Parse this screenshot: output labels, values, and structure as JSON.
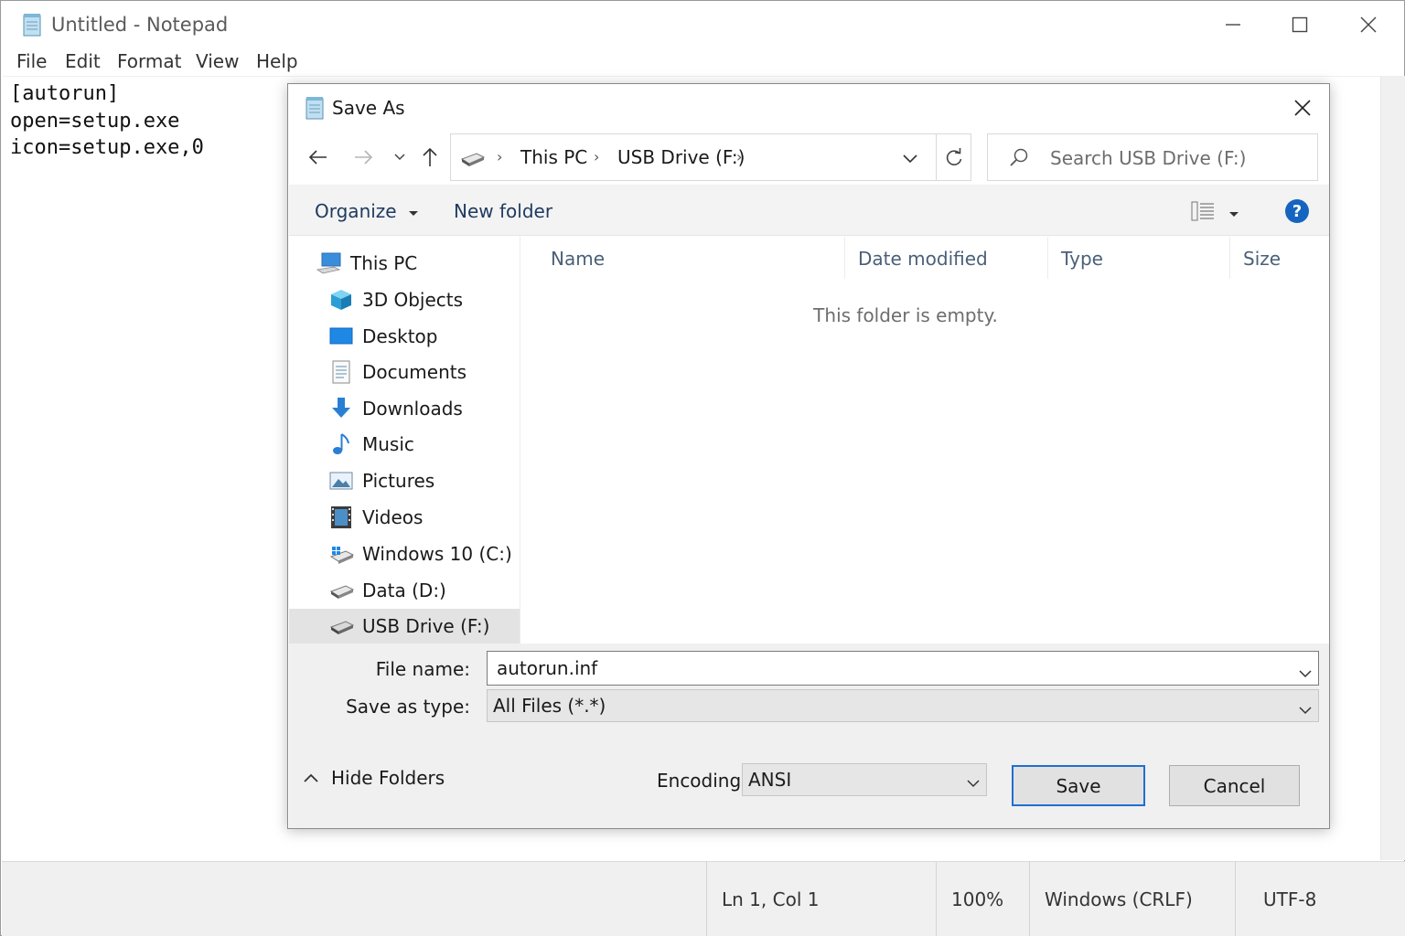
{
  "notepad": {
    "title": "Untitled - Notepad",
    "menu": [
      "File",
      "Edit",
      "Format",
      "View",
      "Help"
    ],
    "content_lines": [
      "[autorun]",
      "open=setup.exe",
      "icon=setup.exe,0"
    ],
    "status": {
      "position": "Ln 1, Col 1",
      "zoom": "100%",
      "line_ending": "Windows (CRLF)",
      "encoding": "UTF-8"
    }
  },
  "dialog": {
    "title": "Save As",
    "breadcrumb": [
      "This PC",
      "USB Drive (F:)"
    ],
    "search_placeholder": "Search USB Drive (F:)",
    "toolbar": {
      "organize": "Organize",
      "new_folder": "New folder",
      "help": "?"
    },
    "nav": {
      "root": "This PC",
      "items": [
        "3D Objects",
        "Desktop",
        "Documents",
        "Downloads",
        "Music",
        "Pictures",
        "Videos",
        "Windows 10 (C:)",
        "Data (D:)",
        "USB Drive (F:)"
      ],
      "selected": "USB Drive (F:)"
    },
    "columns": [
      "Name",
      "Date modified",
      "Type",
      "Size"
    ],
    "empty_message": "This folder is empty.",
    "file_name_label": "File name:",
    "file_name_value": "autorun.inf",
    "save_type_label": "Save as type:",
    "save_type_value": "All Files (*.*)",
    "hide_folders": "Hide Folders",
    "encoding_label": "Encoding:",
    "encoding_value": "ANSI",
    "save_button": "Save",
    "cancel_button": "Cancel"
  },
  "colors": {
    "accent": "#1f6fd1",
    "help_blue": "#1565c0",
    "column_header_text": "#4a6079",
    "selected_nav_bg": "#e3e3e3"
  }
}
